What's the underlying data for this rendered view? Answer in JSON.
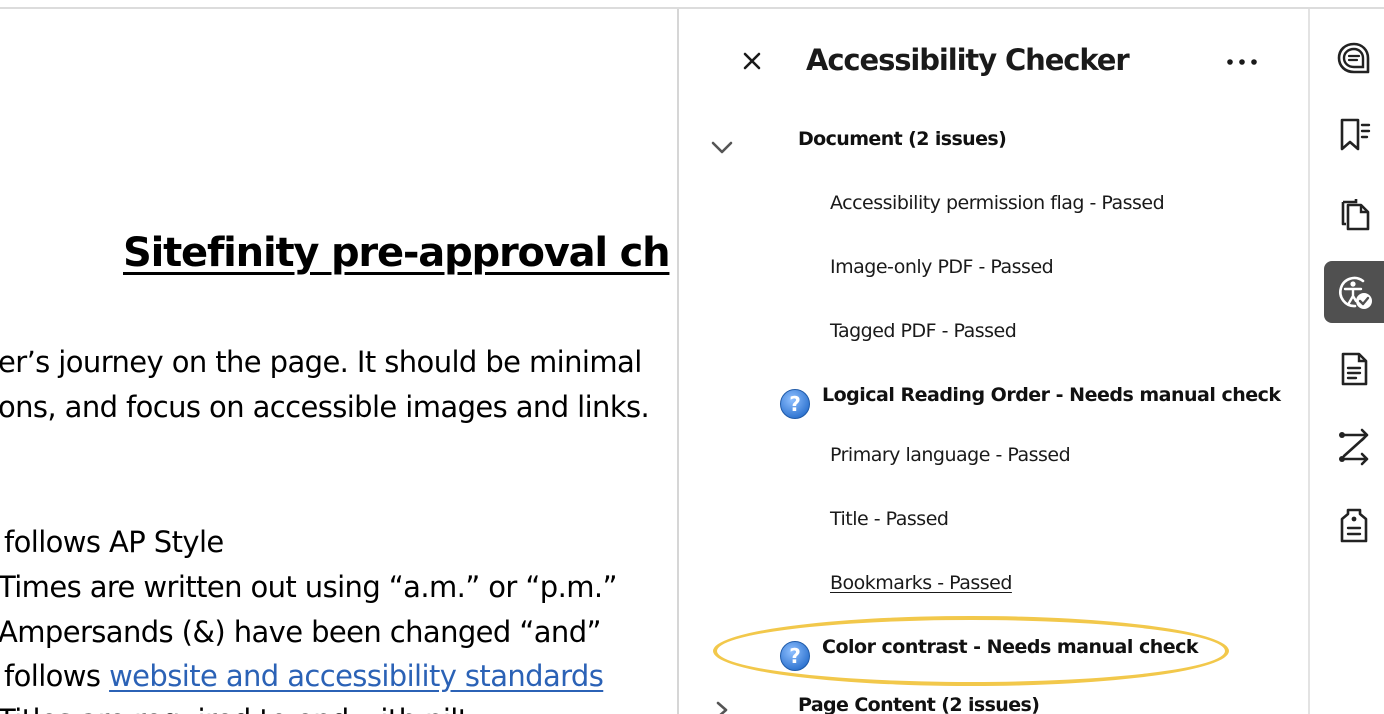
{
  "document": {
    "title_fragment": "Sitefinity pre-approval ch",
    "lines": [
      "er’s journey on the page. It should be minimal",
      "ons, and focus on accessible images and links.",
      "follows AP Style",
      "Times are written out using “a.m.” or “p.m.”",
      "Ampersands (&) have been changed “and”"
    ],
    "link_line_prefix": "follows ",
    "link_text": "website and accessibility standards",
    "partial_bottom_line": "Titles are required to end with nilt"
  },
  "panel": {
    "title": "Accessibility Checker",
    "close_icon": "close-icon",
    "more_icon": "more-options-icon",
    "groups": [
      {
        "label": "Document (2 issues)",
        "expanded": true
      },
      {
        "label": "Page Content (2 issues)",
        "expanded": false
      }
    ],
    "items": [
      {
        "label": "Accessibility permission flag - Passed",
        "status": "passed"
      },
      {
        "label": "Image-only PDF - Passed",
        "status": "passed"
      },
      {
        "label": "Tagged PDF - Passed",
        "status": "passed"
      },
      {
        "label": "Logical Reading Order - Needs manual check",
        "status": "manual"
      },
      {
        "label": "Primary language - Passed",
        "status": "passed"
      },
      {
        "label": "Title - Passed",
        "status": "passed"
      },
      {
        "label": "Bookmarks - Passed",
        "status": "passed"
      },
      {
        "label": "Color contrast - Needs manual check",
        "status": "manual"
      }
    ],
    "highlight_color": "#f2c84b",
    "question_icon_color": "#4a8fdf"
  },
  "rail": {
    "tools": [
      {
        "icon": "comment-icon",
        "active": false
      },
      {
        "icon": "bookmarks-icon",
        "active": false
      },
      {
        "icon": "pages-icon",
        "active": false
      },
      {
        "icon": "accessibility-icon",
        "active": true
      },
      {
        "icon": "document-properties-icon",
        "active": false
      },
      {
        "icon": "compare-icon",
        "active": false
      },
      {
        "icon": "tags-icon",
        "active": false
      }
    ],
    "active_color": "#505050"
  }
}
